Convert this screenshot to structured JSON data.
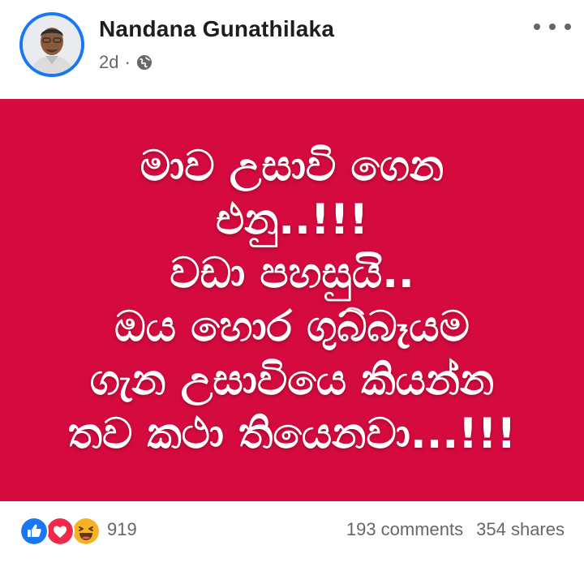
{
  "post": {
    "author": "Nandana Gunathilaka",
    "time": "2d",
    "separator": "·",
    "audience_icon": "globe-icon",
    "more_icon": "more-horizontal-icon",
    "banner": {
      "background_color": "#d50b3f",
      "text_color": "#ffffff",
      "lines": [
        "මාව උසාවි ගෙන",
        "එනු..!!!",
        "වඩා පහසුයි..",
        "ඔය හොර ගුබ්බෑයම",
        "ගැන උසාවියෙ කියන්න",
        "තව කථා තියෙනවා...!!!"
      ]
    },
    "reactions": {
      "icons": [
        "like-icon",
        "love-icon",
        "haha-icon"
      ],
      "count": "919"
    },
    "comments": "193 comments",
    "shares": "354 shares"
  }
}
